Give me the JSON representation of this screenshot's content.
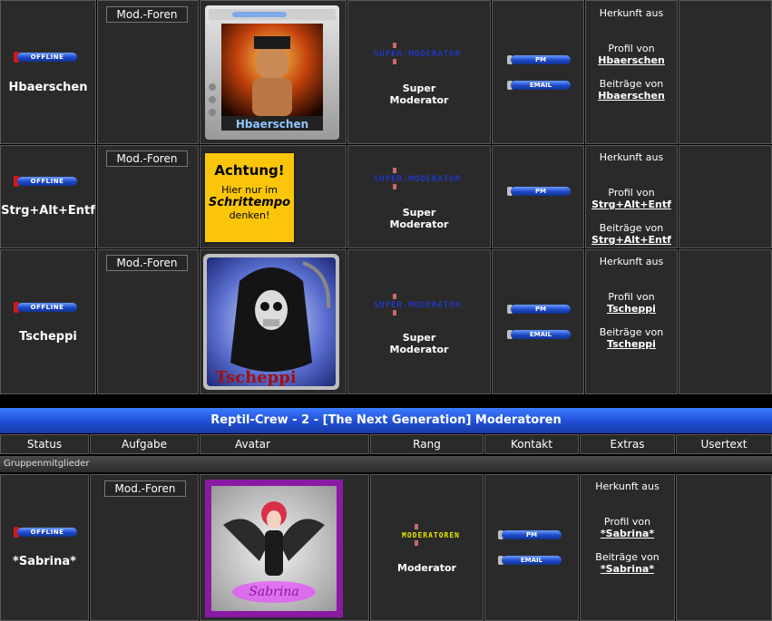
{
  "members_top": [
    {
      "status": "OFFLINE",
      "name": "Hbaerschen",
      "task": "Mod.-Foren",
      "avatar_caption": "Hbaerschen",
      "rank_image_text": "SUPER-MODERATOR",
      "rank": [
        "Super",
        "Moderator"
      ],
      "contact": [
        "PM",
        "EMAIL"
      ],
      "extras": {
        "origin": "Herkunft aus",
        "profile_label": "Profil von",
        "profile_link": "Hbaerschen",
        "posts_label": "Beiträge von",
        "posts_link": "Hbaerschen"
      }
    },
    {
      "status": "OFFLINE",
      "name": "Strg+Alt+Entf",
      "task": "Mod.-Foren",
      "avatar_lines": [
        "Achtung!",
        "Hier nur im",
        "Schrittempo",
        "denken!"
      ],
      "rank_image_text": "SUPER-MODERATOR",
      "rank": [
        "Super",
        "Moderator"
      ],
      "contact": [
        "PM"
      ],
      "extras": {
        "origin": "Herkunft aus",
        "profile_label": "Profil von",
        "profile_link": "Strg+Alt+Entf",
        "posts_label": "Beiträge von",
        "posts_link": "Strg+Alt+Entf"
      }
    },
    {
      "status": "OFFLINE",
      "name": "Tscheppi",
      "task": "Mod.-Foren",
      "avatar_caption": "Tscheppi",
      "rank_image_text": "SUPER-MODERATOR",
      "rank": [
        "Super",
        "Moderator"
      ],
      "contact": [
        "PM",
        "EMAIL"
      ],
      "extras": {
        "origin": "Herkunft aus",
        "profile_label": "Profil von",
        "profile_link": "Tscheppi",
        "posts_label": "Beiträge von",
        "posts_link": "Tscheppi"
      }
    }
  ],
  "group": {
    "title": "Reptil-Crew - 2 - [The Next Generation] Moderatoren",
    "columns": [
      "Status",
      "Aufgabe",
      "Avatar",
      "Rang",
      "Kontakt",
      "Extras",
      "Usertext"
    ],
    "members_label": "Gruppenmitglieder",
    "member": {
      "status": "OFFLINE",
      "name": "*Sabrina*",
      "task": "Mod.-Foren",
      "avatar_caption": "Sabrina",
      "rank_image_text": "MODERATOREN",
      "rank": "Moderator",
      "contact": [
        "PM",
        "EMAIL"
      ],
      "extras": {
        "origin": "Herkunft aus",
        "profile_label": "Profil von",
        "profile_link": "*Sabrina*",
        "posts_label": "Beiträge von",
        "posts_link": "*Sabrina*"
      }
    }
  },
  "colors": {
    "accent_blue": "#2251d8",
    "cell_bg": "#2a2a2a",
    "offline_red": "#d01818",
    "rank_text_super": "#1a3cff",
    "rank_text_mod": "#e8e800"
  }
}
